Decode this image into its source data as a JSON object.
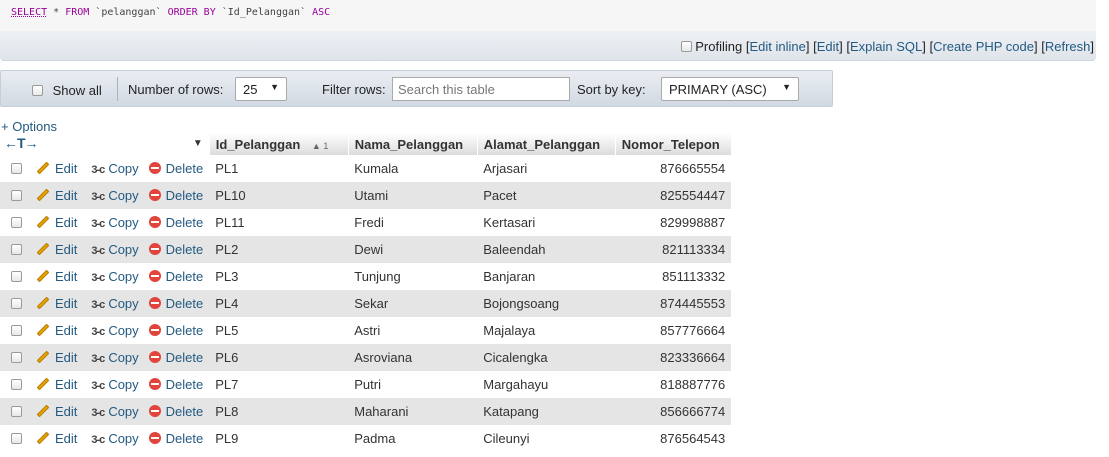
{
  "query": {
    "select_kw": "SELECT",
    "rest_1": " * ",
    "from_kw": "FROM",
    "table": " `pelanggan` ",
    "order_kw": "ORDER BY",
    "column": " `Id_Pelanggan` ",
    "asc_kw": "ASC"
  },
  "profiling": {
    "label": "Profiling",
    "open": "[",
    "edit_inline": "Edit inline",
    "sep": "] [",
    "edit": "Edit",
    "explain": "Explain SQL",
    "create_php": "Create PHP code",
    "refresh": "Refresh",
    "close": "]"
  },
  "nav": {
    "show_all": "Show all",
    "rows_label": "Number of rows:",
    "rows_value": "25",
    "filter_label": "Filter rows:",
    "filter_placeholder": "Search this table",
    "sort_label": "Sort by key:",
    "sort_value": "PRIMARY (ASC)"
  },
  "options_link": "+ Options",
  "resize_arrows": "←T→",
  "columns": [
    "Id_Pelanggan",
    "Nama_Pelanggan",
    "Alamat_Pelanggan",
    "Nomor_Telepon"
  ],
  "sort_indicator": "▲ 1",
  "actions": {
    "edit": "Edit",
    "copy": "Copy",
    "delete": "Delete",
    "copy_glyph": "3-c"
  },
  "rows": [
    [
      "PL1",
      "Kumala",
      "Arjasari",
      "876665554"
    ],
    [
      "PL10",
      "Utami",
      "Pacet",
      "825554447"
    ],
    [
      "PL11",
      "Fredi",
      "Kertasari",
      "829998887"
    ],
    [
      "PL2",
      "Dewi",
      "Baleendah",
      "821113334"
    ],
    [
      "PL3",
      "Tunjung",
      "Banjaran",
      "851113332"
    ],
    [
      "PL4",
      "Sekar",
      "Bojongsoang",
      "874445553"
    ],
    [
      "PL5",
      "Astri",
      "Majalaya",
      "857776664"
    ],
    [
      "PL6",
      "Asroviana",
      "Cicalengka",
      "823336664"
    ],
    [
      "PL7",
      "Putri",
      "Margahayu",
      "818887776"
    ],
    [
      "PL8",
      "Maharani",
      "Katapang",
      "856666774"
    ],
    [
      "PL9",
      "Padma",
      "Cileunyi",
      "876564543"
    ]
  ]
}
